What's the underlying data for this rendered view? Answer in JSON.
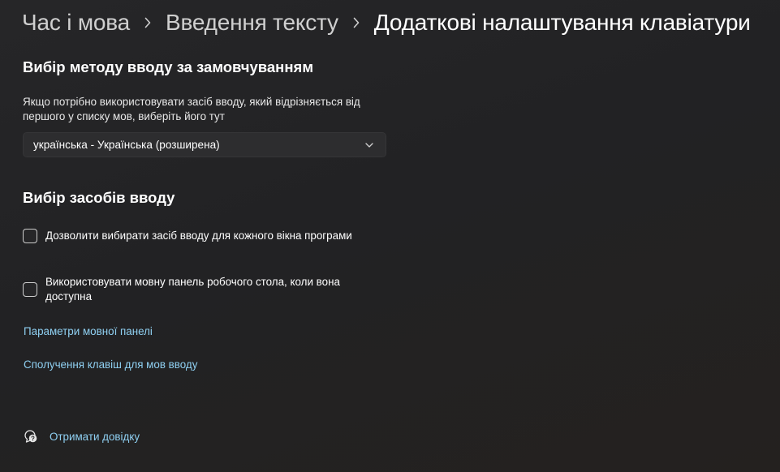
{
  "breadcrumb": {
    "items": [
      "Час і мова",
      "Введення тексту"
    ],
    "current": "Додаткові налаштування клавіатури",
    "separator_icon": "chevron-right-icon"
  },
  "default_input": {
    "title": "Вибір методу вводу за замовчуванням",
    "description": "Якщо потрібно використовувати засіб вводу, який відрізняється від першого у списку мов, виберіть його тут",
    "dropdown_value": "українська - Українська (розширена)",
    "dropdown_icon": "chevron-down-icon"
  },
  "input_switching": {
    "title": "Вибір засобів вводу",
    "checkboxes": [
      {
        "label": "Дозволити вибирати засіб вводу для кожного вікна програми",
        "checked": false
      },
      {
        "label": "Використовувати мовну панель робочого стола, коли вона доступна",
        "checked": false
      }
    ]
  },
  "links": {
    "language_bar_options": "Параметри мовної панелі",
    "hotkeys": "Сполучення клавіш для мов вводу"
  },
  "help": {
    "label": "Отримати довідку",
    "icon": "help-chat-icon"
  },
  "colors": {
    "background": "#232325",
    "accent_link": "#8fd0f2",
    "control_bg": "#2d2d2f"
  }
}
